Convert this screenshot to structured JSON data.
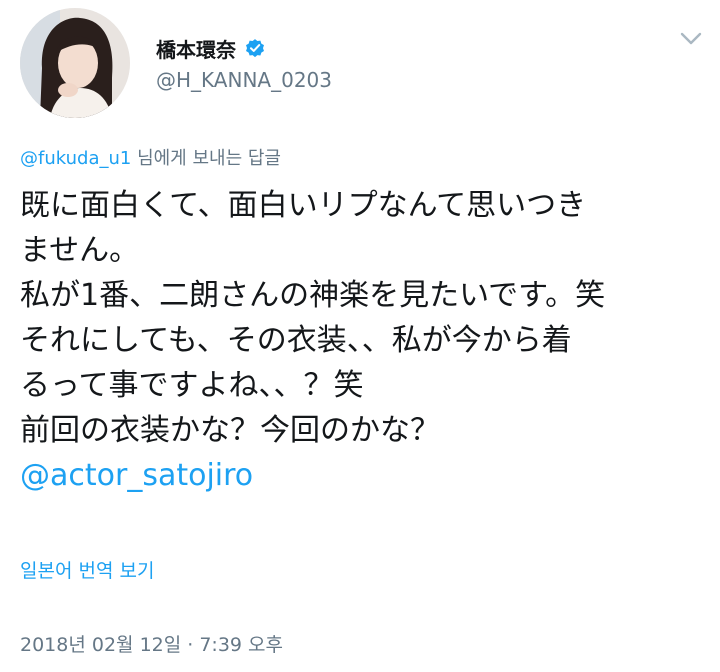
{
  "user": {
    "display_name": "橋本環奈",
    "handle": "@H_KANNA_0203",
    "verified": true
  },
  "reply": {
    "mention": "@fukuda_u1",
    "text": " 님에게 보내는 답글"
  },
  "tweet": {
    "lines": [
      "既に面白くて、面白いリプなんて思いつき",
      "ません。",
      "私が1番、二朗さんの神楽を見たいです。笑",
      "それにしても、その衣装、、私が今から着",
      "るって事ですよね、、？笑",
      "前回の衣装かな？今回のかな？"
    ],
    "mention": "@actor_satojiro"
  },
  "translate_label": "일본어 번역 보기",
  "timestamp": "2018년 02월 12일 · 7:39 오후",
  "icons": {
    "verified": "verified-badge-icon",
    "menu": "chevron-down-icon"
  },
  "colors": {
    "link": "#1da1f2",
    "secondary": "#657786",
    "text": "#14171a"
  }
}
